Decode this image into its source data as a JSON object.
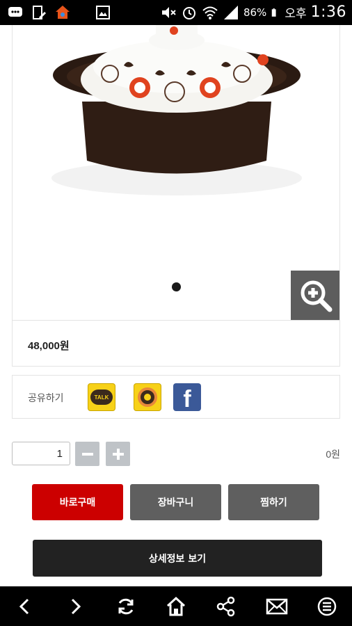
{
  "status_bar": {
    "battery": "86%",
    "ampm": "오후",
    "time": "1:36"
  },
  "product": {
    "image_name": "ceramic-pot-with-floral-lid",
    "price": "48,000원",
    "carousel_dots": 1
  },
  "share": {
    "label": "공유하기",
    "kakaotalk_text": "TALK",
    "facebook_text": "f"
  },
  "quantity": {
    "value": "1",
    "minus": "−",
    "plus": "+",
    "total": "0원"
  },
  "actions": {
    "buy_now": "바로구매",
    "cart": "장바구니",
    "wishlist": "찜하기",
    "detail": "상세정보 보기"
  },
  "colors": {
    "buy": "#cc0000",
    "secondary": "#5f5f5f",
    "detail": "#222222"
  }
}
